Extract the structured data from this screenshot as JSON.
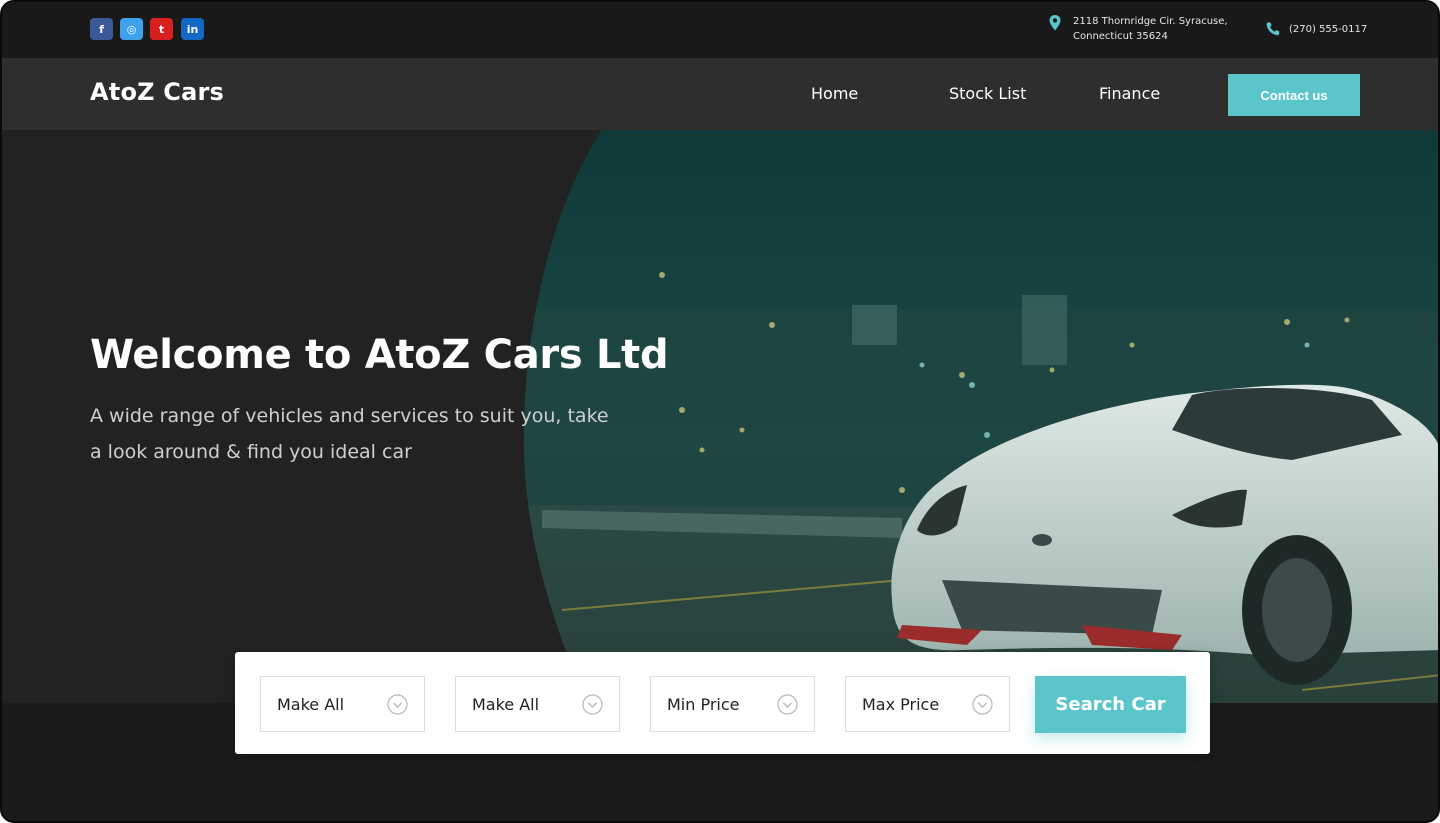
{
  "social": {
    "facebook_glyph": "f",
    "instagram_glyph": "◎",
    "twitter_glyph": "t",
    "linkedin_glyph": "in"
  },
  "contact_info": {
    "address_line1": "2118 Thornridge Cir. Syracuse,",
    "address_line2": "Connecticut 35624",
    "phone": "(270) 555-0117"
  },
  "nav": {
    "brand": "AtoZ Cars",
    "items": [
      {
        "label": "Home"
      },
      {
        "label": "Stock List"
      },
      {
        "label": "Finance"
      }
    ],
    "contact_button": "Contact us"
  },
  "hero": {
    "title": "Welcome to AtoZ Cars Ltd",
    "subtitle": "A wide range of vehicles and services to suit you, take a look around & find you ideal car"
  },
  "search": {
    "filters": [
      {
        "label": "Make All"
      },
      {
        "label": "Make All"
      },
      {
        "label": "Min Price"
      },
      {
        "label": "Max Price"
      }
    ],
    "button": "Search Car"
  },
  "colors": {
    "accent": "#5ac6cb",
    "dark_bg": "#222222",
    "nav_bg": "#2e2e2e",
    "top_bg": "#191919"
  }
}
